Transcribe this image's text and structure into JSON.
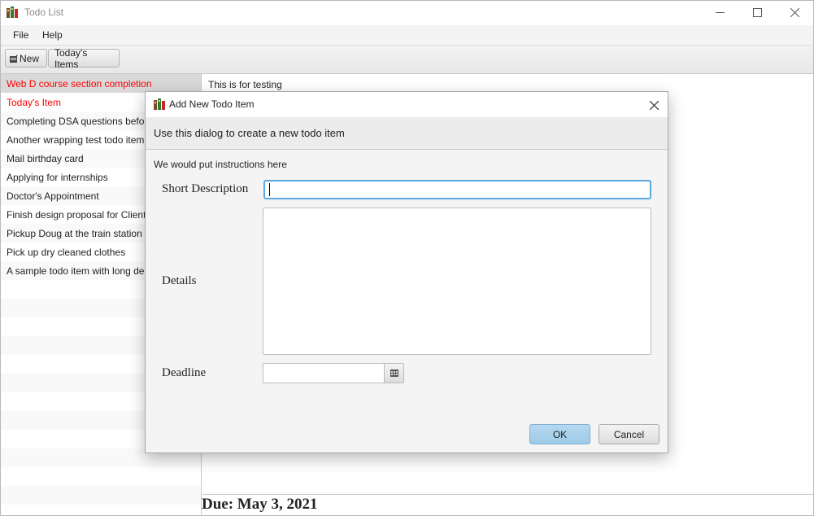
{
  "window": {
    "title": "Todo List",
    "icon": "todo-app-icon",
    "controls": [
      "minimize-icon",
      "maximize-icon",
      "close-icon"
    ]
  },
  "menu": {
    "file": "File",
    "help": "Help"
  },
  "toolbar": {
    "new_label": "New",
    "new_icon": "new-item-icon",
    "today_label": "Today's Items"
  },
  "todo_list": [
    {
      "label": "Web D course section completion",
      "state": "selected",
      "color": "#ff0000"
    },
    {
      "label": "Today's Item",
      "color": "#ff0000"
    },
    {
      "label": "Completing DSA questions before"
    },
    {
      "label": "Another wrapping test todo item"
    },
    {
      "label": "Mail birthday card"
    },
    {
      "label": "Applying for internships"
    },
    {
      "label": "Doctor's Appointment"
    },
    {
      "label": "Finish design proposal for Client"
    },
    {
      "label": "Pickup Doug at the train station"
    },
    {
      "label": "Pick up dry cleaned clothes"
    },
    {
      "label": "A sample todo item with long de"
    }
  ],
  "details": {
    "text": "This is for testing",
    "due": "Due: May 3, 2021"
  },
  "dialog": {
    "title": "Add New Todo Item",
    "header": "Use this dialog to create a new todo item",
    "instructions": "We would put instructions here",
    "short_description_label": "Short Description",
    "short_description_value": "",
    "details_label": "Details",
    "details_value": "",
    "deadline_label": "Deadline",
    "deadline_value": "",
    "calendar_icon": "calendar-icon",
    "ok_label": "OK",
    "cancel_label": "Cancel"
  },
  "colors": {
    "accent_focus": "#5aa7e2",
    "ok_button": "#a8d1ec",
    "due_overdue": "#ff0000"
  }
}
